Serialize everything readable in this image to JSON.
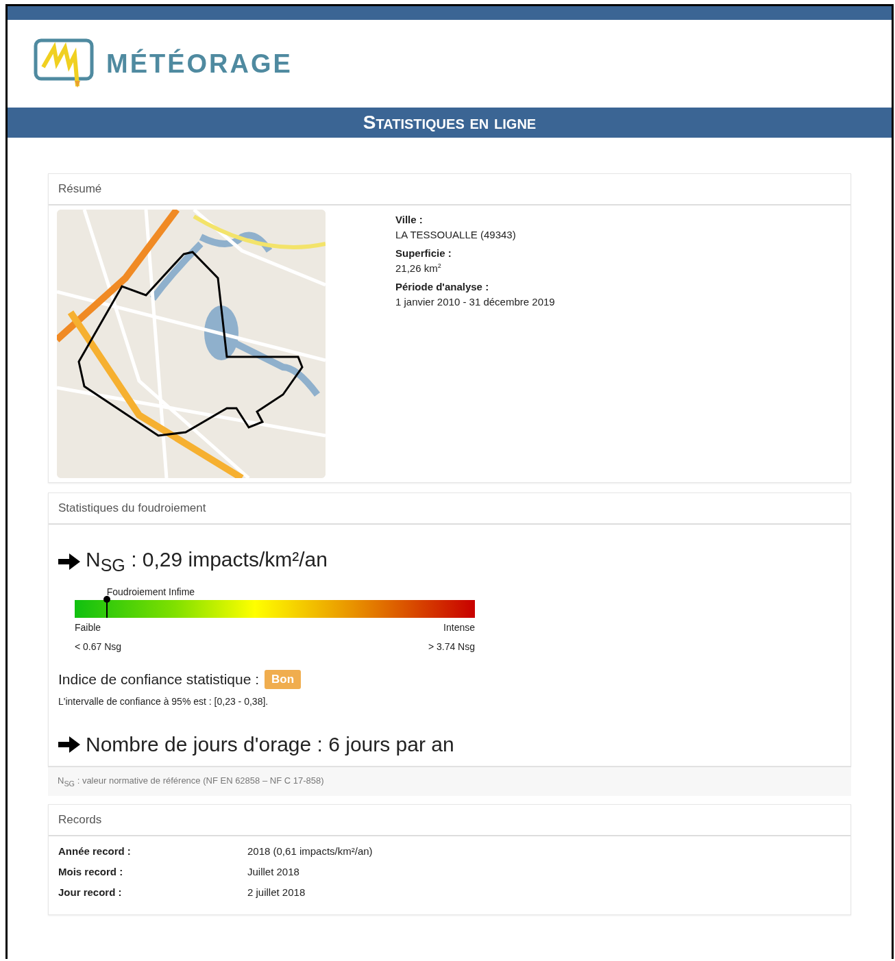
{
  "header": {
    "brand": "MÉTÉORAGE",
    "title": "Statistiques en ligne"
  },
  "summary": {
    "heading": "Résumé",
    "fields": [
      {
        "label": "Ville :",
        "value": "LA TESSOUALLE (49343)"
      },
      {
        "label": "Superficie :",
        "value": "21,26 km$^{2}$"
      },
      {
        "label": "Période d'analyse :",
        "value": "1 janvier 2010 - 31 décembre 2019"
      }
    ]
  },
  "lightning": {
    "heading": "Statistiques du foudroiement",
    "nsg": "N$_{SG}$ : 0,29 impacts/km²/an",
    "gauge": {
      "marker_label": "Foudroiement Infime",
      "level": 0.08,
      "low_label": "Faible",
      "high_label": "Intense",
      "low_value": "< 0.67 Nsg",
      "high_value": "> 3.74 Nsg"
    },
    "confidence_label": "Indice de confiance statistique :",
    "confidence_badge": "Bon",
    "interval": "L'intervalle de confiance à 95% est : [0,23 - 0,38].",
    "storm_days": "Nombre de jours d'orage : 6 jours par an",
    "footnote": "N$_{SG}$ : valeur normative de référence (NF EN 62858 – NF C 17-858)"
  },
  "records": {
    "heading": "Records",
    "rows": [
      {
        "label": "Année record :",
        "value": "2018 (0,61 impacts/km²/an)"
      },
      {
        "label": "Mois record :",
        "value": "Juillet 2018"
      },
      {
        "label": "Jour record :",
        "value": "2 juillet 2018"
      }
    ]
  }
}
